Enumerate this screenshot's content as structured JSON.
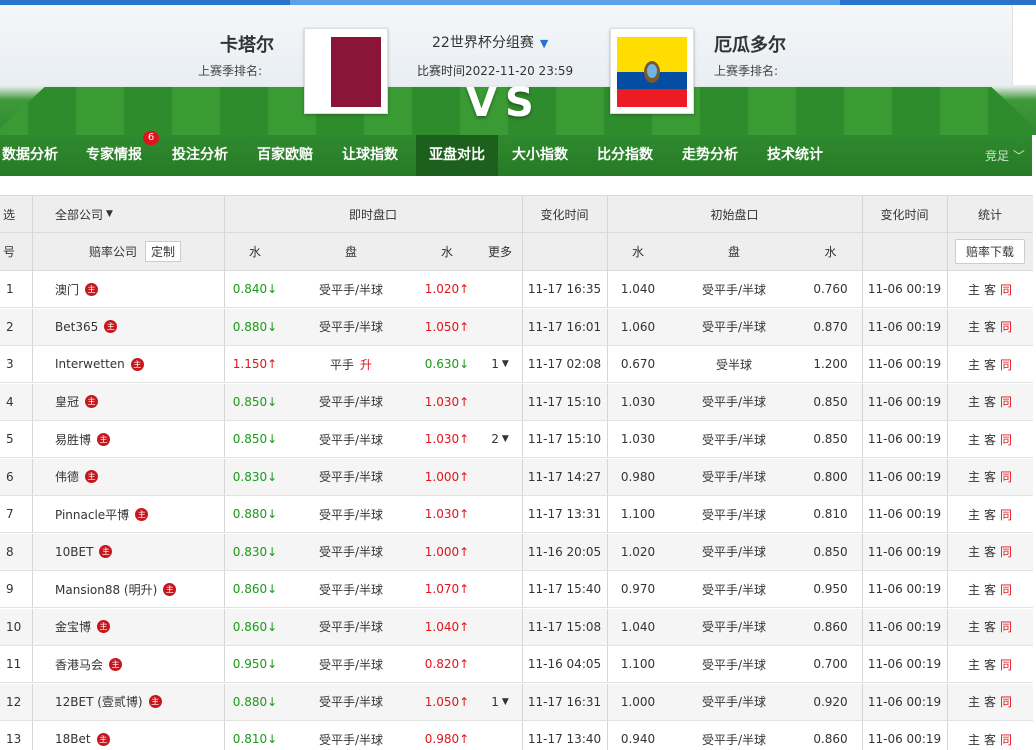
{
  "header": {
    "home": {
      "name": "卡塔尔",
      "rank_label": "上赛季排名:"
    },
    "away": {
      "name": "厄瓜多尔",
      "rank_label": "上赛季排名:"
    },
    "league": "22世界杯分组赛",
    "match_time": "比赛时间2022-11-20 23:59",
    "vs": "VS"
  },
  "nav": {
    "items": [
      "数据分析",
      "专家情报",
      "投注分析",
      "百家欧赔",
      "让球指数",
      "亚盘对比",
      "大小指数",
      "比分指数",
      "走势分析",
      "技术统计"
    ],
    "active": "亚盘对比",
    "badge": "6",
    "right_label": "竞足"
  },
  "table": {
    "head1": {
      "select": "选",
      "company_filter": "全部公司",
      "live": "即时盘口",
      "change_time": "变化时间",
      "initial": "初始盘口",
      "change_time2": "变化时间",
      "stats": "统计"
    },
    "head2": {
      "no": "号",
      "company": "赔率公司",
      "customize": "定制",
      "water1": "水",
      "handicap": "盘",
      "water2": "水",
      "more": "更多",
      "iwater1": "水",
      "ihandicap": "盘",
      "iwater2": "水",
      "download": "赔率下载"
    },
    "hot_icon": "主",
    "stat_labels": [
      "主",
      "客",
      "同"
    ],
    "colors": {
      "up": "#e1141c",
      "down": "#1a9a1a"
    },
    "rows": [
      {
        "no": "1",
        "company": "澳门",
        "w1": "0.840",
        "w1_dir": "down",
        "hc": "受平手/半球",
        "hc_ext": "",
        "w2": "1.020",
        "w2_dir": "up",
        "more": "",
        "time": "11-17 16:35",
        "iw1": "1.040",
        "ihc": "受平手/半球",
        "iw2": "0.760",
        "itime": "11-06 00:19"
      },
      {
        "no": "2",
        "company": "Bet365",
        "w1": "0.880",
        "w1_dir": "down",
        "hc": "受平手/半球",
        "hc_ext": "",
        "w2": "1.050",
        "w2_dir": "up",
        "more": "",
        "time": "11-17 16:01",
        "iw1": "1.060",
        "ihc": "受平手/半球",
        "iw2": "0.870",
        "itime": "11-06 00:19"
      },
      {
        "no": "3",
        "company": "Interwetten",
        "w1": "1.150",
        "w1_dir": "up",
        "hc": "平手",
        "hc_ext": "升",
        "w2": "0.630",
        "w2_dir": "down",
        "more": "1",
        "time": "11-17 02:08",
        "iw1": "0.670",
        "ihc": "受半球",
        "iw2": "1.200",
        "itime": "11-06 00:19"
      },
      {
        "no": "4",
        "company": "皇冠",
        "w1": "0.850",
        "w1_dir": "down",
        "hc": "受平手/半球",
        "hc_ext": "",
        "w2": "1.030",
        "w2_dir": "up",
        "more": "",
        "time": "11-17 15:10",
        "iw1": "1.030",
        "ihc": "受平手/半球",
        "iw2": "0.850",
        "itime": "11-06 00:19"
      },
      {
        "no": "5",
        "company": "易胜博",
        "w1": "0.850",
        "w1_dir": "down",
        "hc": "受平手/半球",
        "hc_ext": "",
        "w2": "1.030",
        "w2_dir": "up",
        "more": "2",
        "time": "11-17 15:10",
        "iw1": "1.030",
        "ihc": "受平手/半球",
        "iw2": "0.850",
        "itime": "11-06 00:19"
      },
      {
        "no": "6",
        "company": "伟德",
        "w1": "0.830",
        "w1_dir": "down",
        "hc": "受平手/半球",
        "hc_ext": "",
        "w2": "1.000",
        "w2_dir": "up",
        "more": "",
        "time": "11-17 14:27",
        "iw1": "0.980",
        "ihc": "受平手/半球",
        "iw2": "0.800",
        "itime": "11-06 00:19"
      },
      {
        "no": "7",
        "company": "Pinnacle平博",
        "w1": "0.880",
        "w1_dir": "down",
        "hc": "受平手/半球",
        "hc_ext": "",
        "w2": "1.030",
        "w2_dir": "up",
        "more": "",
        "time": "11-17 13:31",
        "iw1": "1.100",
        "ihc": "受平手/半球",
        "iw2": "0.810",
        "itime": "11-06 00:19"
      },
      {
        "no": "8",
        "company": "10BET",
        "w1": "0.830",
        "w1_dir": "down",
        "hc": "受平手/半球",
        "hc_ext": "",
        "w2": "1.000",
        "w2_dir": "up",
        "more": "",
        "time": "11-16 20:05",
        "iw1": "1.020",
        "ihc": "受平手/半球",
        "iw2": "0.850",
        "itime": "11-06 00:19"
      },
      {
        "no": "9",
        "company": "Mansion88 (明升)",
        "w1": "0.860",
        "w1_dir": "down",
        "hc": "受平手/半球",
        "hc_ext": "",
        "w2": "1.070",
        "w2_dir": "up",
        "more": "",
        "time": "11-17 15:40",
        "iw1": "0.970",
        "ihc": "受平手/半球",
        "iw2": "0.950",
        "itime": "11-06 00:19"
      },
      {
        "no": "10",
        "company": "金宝博",
        "w1": "0.860",
        "w1_dir": "down",
        "hc": "受平手/半球",
        "hc_ext": "",
        "w2": "1.040",
        "w2_dir": "up",
        "more": "",
        "time": "11-17 15:08",
        "iw1": "1.040",
        "ihc": "受平手/半球",
        "iw2": "0.860",
        "itime": "11-06 00:19"
      },
      {
        "no": "11",
        "company": "香港马会",
        "w1": "0.950",
        "w1_dir": "down",
        "hc": "受平手/半球",
        "hc_ext": "",
        "w2": "0.820",
        "w2_dir": "up",
        "more": "",
        "time": "11-16 04:05",
        "iw1": "1.100",
        "ihc": "受平手/半球",
        "iw2": "0.700",
        "itime": "11-06 00:19"
      },
      {
        "no": "12",
        "company": "12BET (壹贰博)",
        "w1": "0.880",
        "w1_dir": "down",
        "hc": "受平手/半球",
        "hc_ext": "",
        "w2": "1.050",
        "w2_dir": "up",
        "more": "1",
        "time": "11-17 16:31",
        "iw1": "1.000",
        "ihc": "受平手/半球",
        "iw2": "0.920",
        "itime": "11-06 00:19"
      },
      {
        "no": "13",
        "company": "18Bet",
        "w1": "0.810",
        "w1_dir": "down",
        "hc": "受平手/半球",
        "hc_ext": "",
        "w2": "0.980",
        "w2_dir": "up",
        "more": "",
        "time": "11-17 13:40",
        "iw1": "0.940",
        "ihc": "受平手/半球",
        "iw2": "0.860",
        "itime": "11-06 00:19"
      }
    ]
  }
}
